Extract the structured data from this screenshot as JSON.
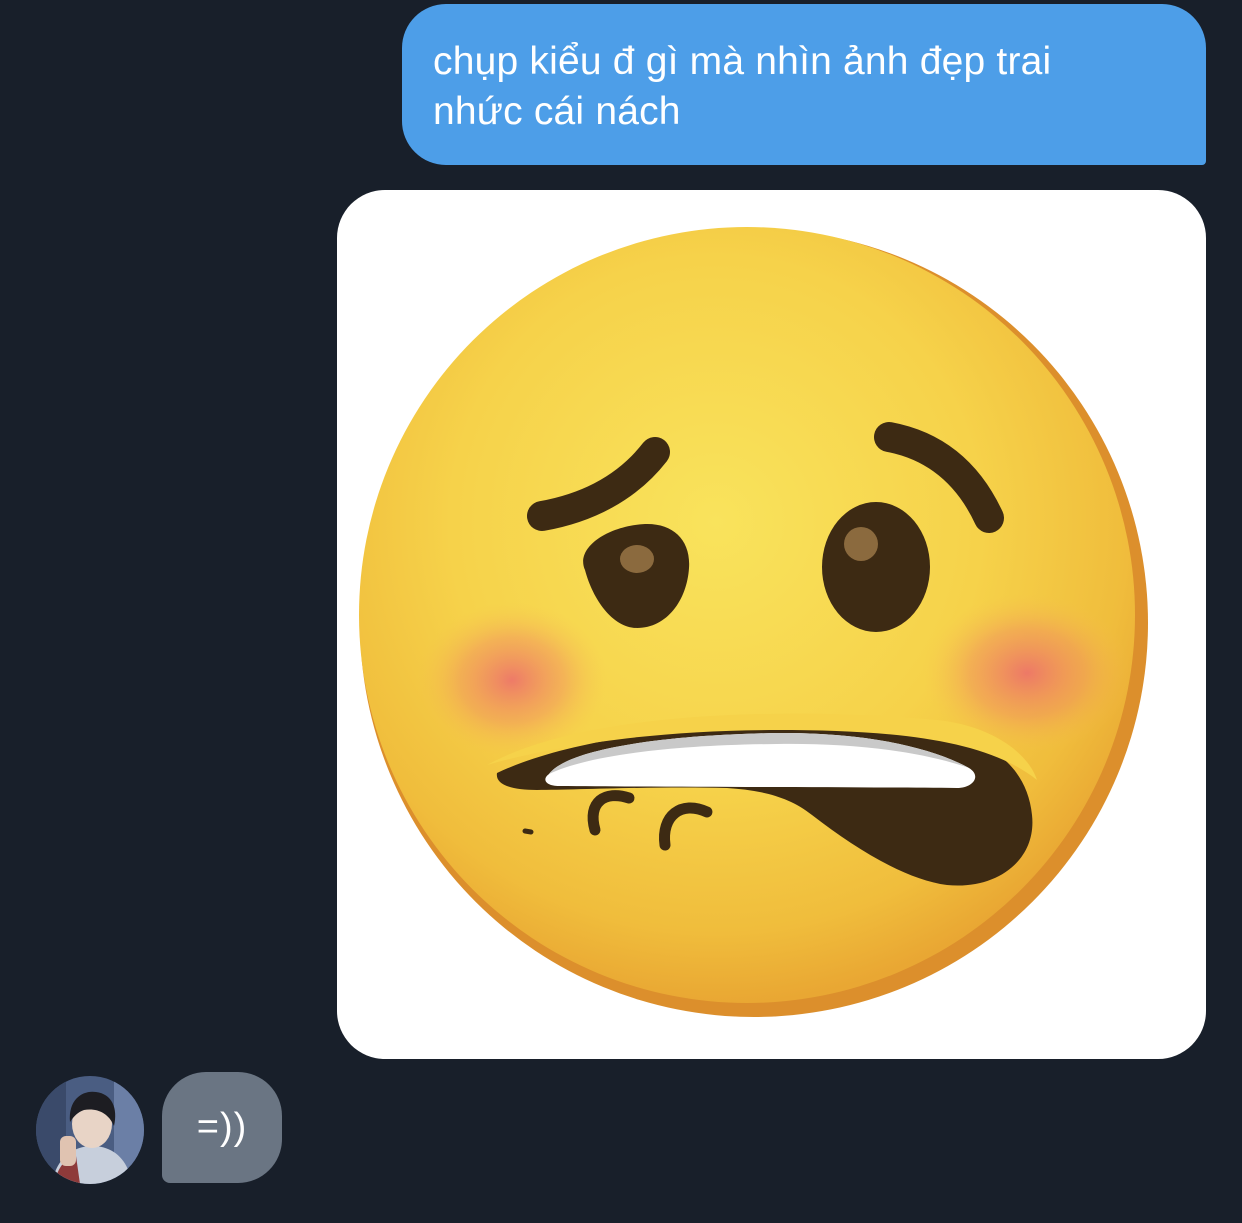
{
  "conversation": {
    "outgoing": {
      "lines": [
        "chụp kiểu đ gì mà nhìn ảnh đẹp trai",
        "nhức cái nách"
      ],
      "bubble_color": "#4d9ee8"
    },
    "image_message": {
      "content": "emoji-face-biting-lip-icon"
    },
    "incoming": {
      "text": "=))",
      "bubble_color": "#6a7583",
      "avatar": "contact-avatar"
    }
  },
  "colors": {
    "background": "#181f2a",
    "emoji_yellow": "#f7d54e",
    "emoji_feature": "#3d2a13"
  }
}
